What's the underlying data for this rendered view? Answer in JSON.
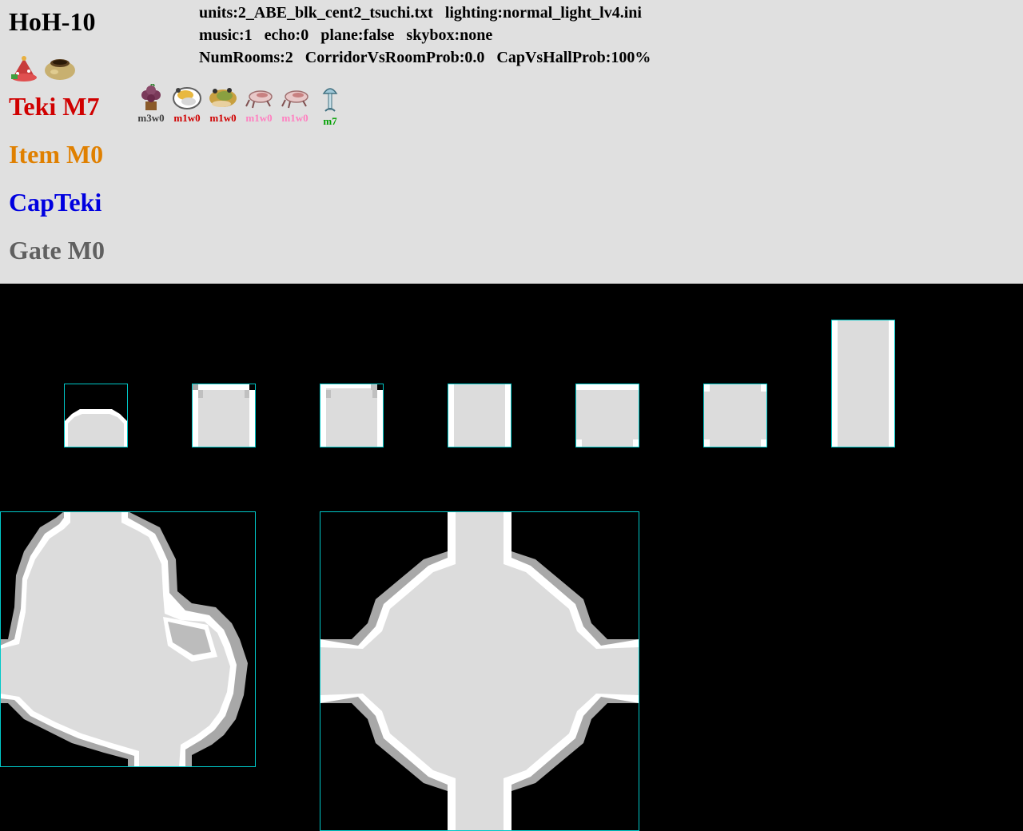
{
  "title": "HoH-10",
  "header_info": {
    "line1": "units:2_ABE_blk_cent2_tsuchi.txt   lighting:normal_light_lv4.ini",
    "line2": "music:1   echo:0   plane:false   skybox:none",
    "line3": "NumRooms:2   CorridorVsRoomProb:0.0   CapVsHallProb:100%"
  },
  "treasure_icons": [
    "flower-pot-icon",
    "clay-pot-icon"
  ],
  "categories": {
    "teki": {
      "label": "Teki M7",
      "color": "#d00000"
    },
    "item": {
      "label": "Item M0",
      "color": "#e08000"
    },
    "capteki": {
      "label": "CapTeki",
      "color": "#0000e0"
    },
    "gate": {
      "label": "Gate M0",
      "color": "#606060"
    }
  },
  "teki_list": [
    {
      "icon": "berry-bush-icon",
      "label": "m3w0",
      "color": "#404040"
    },
    {
      "icon": "shell-creature-icon",
      "label": "m1w0",
      "color": "#d00000"
    },
    {
      "icon": "frog-creature-icon",
      "label": "m1w0",
      "color": "#d00000"
    },
    {
      "icon": "mite-creature-icon",
      "label": "m1w0",
      "color": "#ff80c0"
    },
    {
      "icon": "mite-creature-icon",
      "label": "m1w0",
      "color": "#ff80c0"
    },
    {
      "icon": "mushroom-icon",
      "label": "m7",
      "color": "#00a000"
    }
  ],
  "colors": {
    "header_bg": "#e0e0e0",
    "map_bg": "#000000",
    "floor": "#dcdcdc",
    "wall_white": "#ffffff",
    "wall_gray": "#a8a8a8",
    "tile_border": "#00c8c8"
  }
}
